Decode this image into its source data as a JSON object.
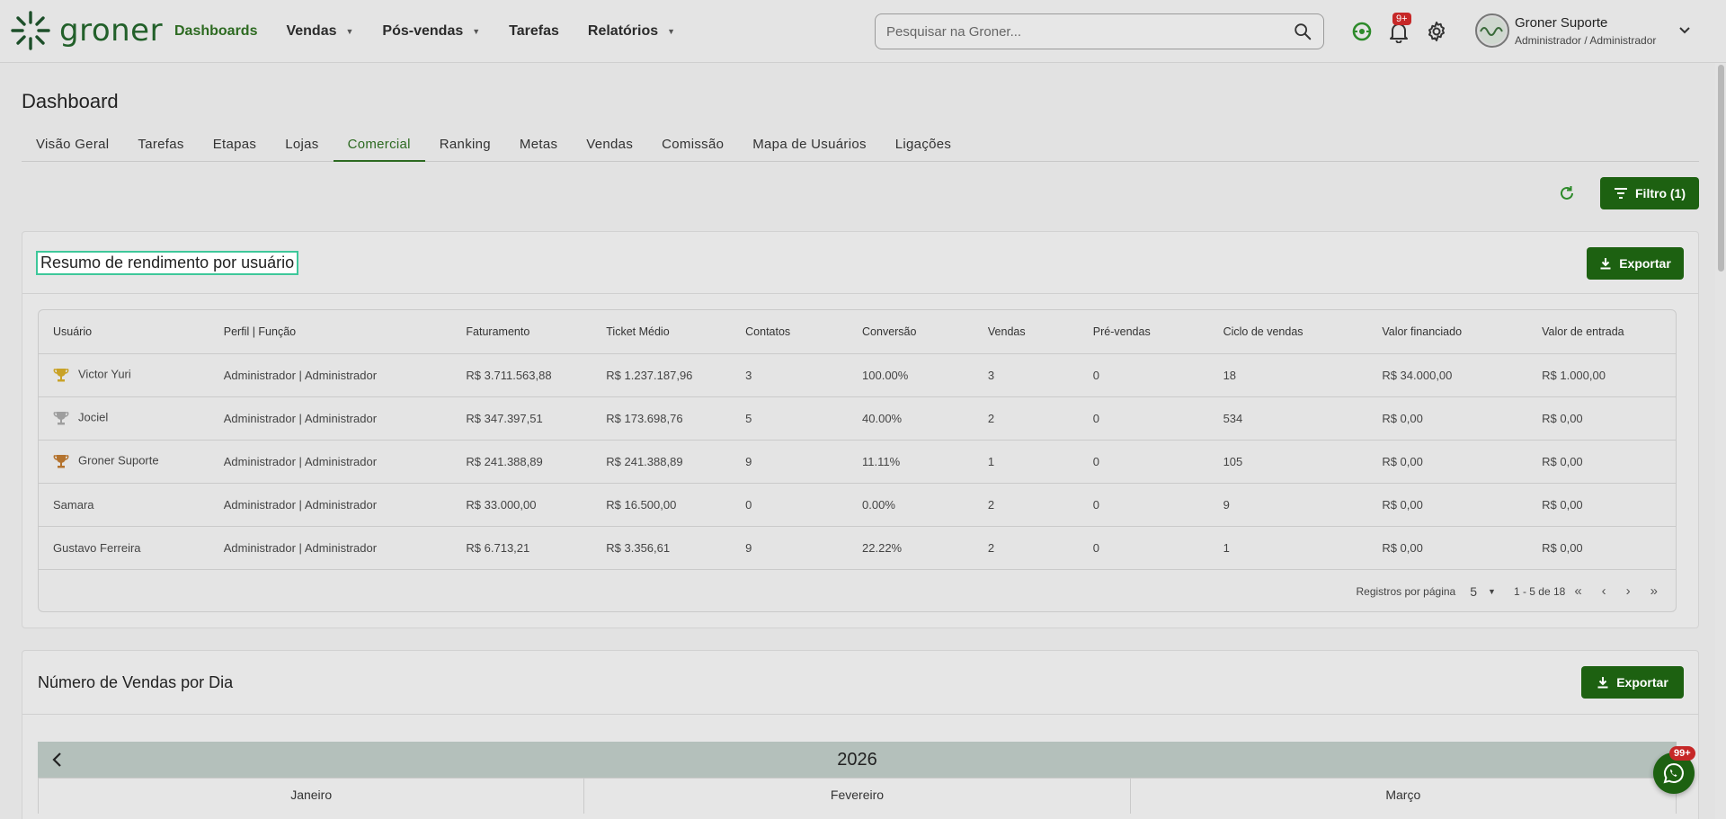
{
  "brand": {
    "name": "groner",
    "color": "#2d6a21"
  },
  "nav": {
    "items": [
      {
        "label": "Dashboards",
        "active": true,
        "dropdown": false
      },
      {
        "label": "Vendas",
        "active": false,
        "dropdown": true
      },
      {
        "label": "Pós-vendas",
        "active": false,
        "dropdown": true
      },
      {
        "label": "Tarefas",
        "active": false,
        "dropdown": false
      },
      {
        "label": "Relatórios",
        "active": false,
        "dropdown": true
      }
    ]
  },
  "search": {
    "placeholder": "Pesquisar na Groner...",
    "icon": "search-icon"
  },
  "notifications": {
    "badge": "9+"
  },
  "user": {
    "name": "Groner Suporte",
    "role": "Administrador / Administrador"
  },
  "page": {
    "title": "Dashboard"
  },
  "tabs": [
    {
      "label": "Visão Geral",
      "active": false
    },
    {
      "label": "Tarefas",
      "active": false
    },
    {
      "label": "Etapas",
      "active": false
    },
    {
      "label": "Lojas",
      "active": false
    },
    {
      "label": "Comercial",
      "active": true
    },
    {
      "label": "Ranking",
      "active": false
    },
    {
      "label": "Metas",
      "active": false
    },
    {
      "label": "Vendas",
      "active": false
    },
    {
      "label": "Comissão",
      "active": false
    },
    {
      "label": "Mapa de Usuários",
      "active": false
    },
    {
      "label": "Ligações",
      "active": false
    }
  ],
  "toolbar": {
    "filter_label": "Filtro (1)"
  },
  "summary": {
    "title": "Resumo de rendimento por usuário",
    "export_label": "Exportar",
    "columns": [
      "Usuário",
      "Perfil | Função",
      "Faturamento",
      "Ticket Médio",
      "Contatos",
      "Conversão",
      "Vendas",
      "Pré-vendas",
      "Ciclo de vendas",
      "Valor financiado",
      "Valor de entrada"
    ],
    "rows": [
      {
        "trophy": "gold",
        "cells": [
          "Victor Yuri",
          "Administrador | Administrador",
          "R$ 3.711.563,88",
          "R$ 1.237.187,96",
          "3",
          "100.00%",
          "3",
          "0",
          "18",
          "R$ 34.000,00",
          "R$ 1.000,00"
        ]
      },
      {
        "trophy": "silver",
        "cells": [
          "Jociel",
          "Administrador | Administrador",
          "R$ 347.397,51",
          "R$ 173.698,76",
          "5",
          "40.00%",
          "2",
          "0",
          "534",
          "R$ 0,00",
          "R$ 0,00"
        ]
      },
      {
        "trophy": "bronze",
        "cells": [
          "Groner Suporte",
          "Administrador | Administrador",
          "R$ 241.388,89",
          "R$ 241.388,89",
          "9",
          "11.11%",
          "1",
          "0",
          "105",
          "R$ 0,00",
          "R$ 0,00"
        ]
      },
      {
        "trophy": "",
        "cells": [
          "Samara",
          "Administrador | Administrador",
          "R$ 33.000,00",
          "R$ 16.500,00",
          "0",
          "0.00%",
          "2",
          "0",
          "9",
          "R$ 0,00",
          "R$ 0,00"
        ]
      },
      {
        "trophy": "",
        "cells": [
          "Gustavo Ferreira",
          "Administrador | Administrador",
          "R$ 6.713,21",
          "R$ 3.356,61",
          "9",
          "22.22%",
          "2",
          "0",
          "1",
          "R$ 0,00",
          "R$ 0,00"
        ]
      }
    ],
    "pagination": {
      "per_page_label": "Registros por página",
      "per_page": "5",
      "range": "1 - 5 de 18"
    }
  },
  "sales_per_day": {
    "title": "Número de Vendas por Dia",
    "export_label": "Exportar",
    "year": "2026",
    "months": [
      "Janeiro",
      "Fevereiro",
      "Março"
    ]
  },
  "whatsapp": {
    "badge": "99+"
  },
  "colors": {
    "accent": "#1d6111",
    "gold": "#c9a227",
    "silver": "#9e9e9e",
    "bronze": "#b4732e",
    "highlight": "#3ec79a"
  }
}
